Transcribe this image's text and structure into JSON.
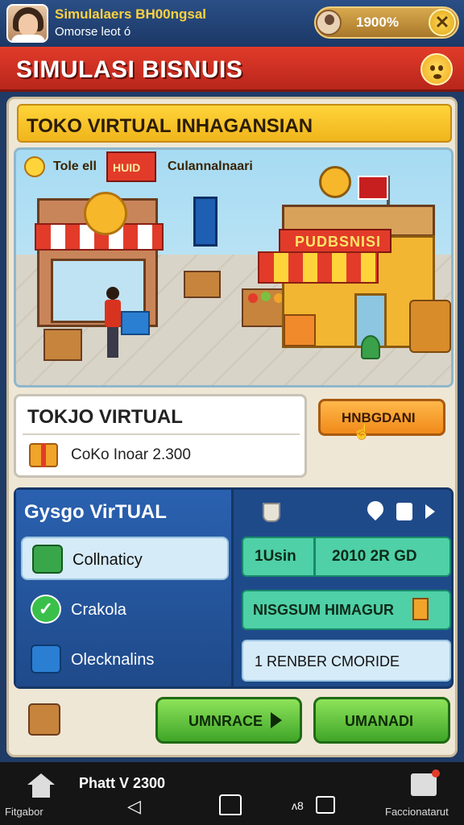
{
  "status": {
    "user_name": "Simulalaers BH00ngsal",
    "user_sub": "Omorse leot ó",
    "coins": "1900%"
  },
  "header": {
    "title": "SIMULASI BISNUIS"
  },
  "banner": {
    "text": "TOKO VIRTUAL INHAGANSIAN"
  },
  "scene": {
    "label_left": "Tole ell",
    "label_center": "Culannalnaari",
    "sign_left": "HUID",
    "shop_sign": "PUDBSNISI"
  },
  "store_card": {
    "title": "TOKJO VIRTUAL",
    "subtitle": "CoKo Inoar 2.300",
    "action_label": "HNBGDANI"
  },
  "left_panel": {
    "title": "Gysgo VirTUAL",
    "items": [
      {
        "label": "Collnaticy",
        "icon": "cart-icon"
      },
      {
        "label": "Crakola",
        "icon": "check-icon"
      },
      {
        "label": "Olecknalins",
        "icon": "crate-icon"
      }
    ]
  },
  "right_panel": {
    "row1_cell1": "1Usin",
    "row1_cell2": "2010 2R GD",
    "row2": "NISGSUM HIMAGUR",
    "row3": "1 RENBER CMORIDE"
  },
  "actions": {
    "button1": "UMNRACE",
    "button2": "UMANADI"
  },
  "navbar": {
    "left_label": "Fitgabor",
    "center_text": "Phatt V 2300",
    "right_label": "Faccionatarut"
  },
  "colors": {
    "title_red": "#e23b2a",
    "banner_yellow": "#ffd43a",
    "panel_blue": "#1f4a8a",
    "accent_green": "#4fd0a6",
    "button_green": "#3fa528"
  }
}
